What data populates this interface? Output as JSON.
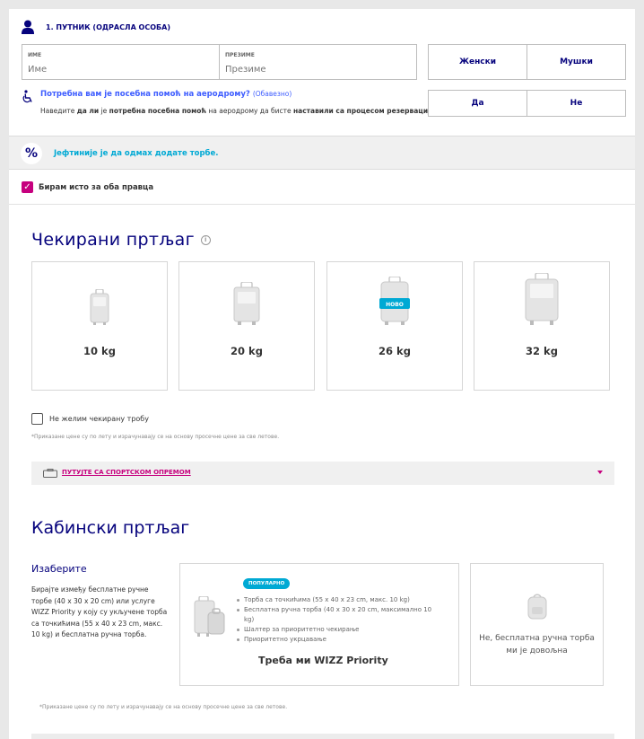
{
  "passenger": {
    "title": "1. ПУТНИК (ОДРАСЛА ОСОБА)",
    "first_name_label": "ИМЕ",
    "first_name_placeholder": "Име",
    "last_name_label": "ПРЕЗИМЕ",
    "last_name_placeholder": "Презиме",
    "gender_female": "Женски",
    "gender_male": "Мушки"
  },
  "assistance": {
    "question": "Потребна вам је посебна помоћ на аеродрому?",
    "optional": "(Обавезно)",
    "desc_1": "Наведите ",
    "desc_2": "да ли",
    "desc_3": " је ",
    "desc_4": "потребна посебна помоћ",
    "desc_5": " на аеродрому да бисте ",
    "desc_6": "наставили са процесом резервације.",
    "yes": "Да",
    "no": "Не"
  },
  "promo": {
    "icon": "%",
    "text": "Јефтиније је да одмах додате торбе."
  },
  "both_directions": {
    "label": "Бирам исто за оба правца",
    "checked": true
  },
  "checked_baggage": {
    "heading": "Чекирани пртљаг",
    "info_icon": "i",
    "options": [
      {
        "weight": "10 kg"
      },
      {
        "weight": "20 kg"
      },
      {
        "weight": "26 kg",
        "badge": "НОВО"
      },
      {
        "weight": "32 kg"
      }
    ],
    "no_bag_label": "Не желим чекирану тробу",
    "note": "*Приказане цене су по лету и израчунавају се на основу просечне цене за све летове."
  },
  "sport": {
    "label": "ПУТУЈТЕ СА СПОРТСКОМ ОПРЕМОМ"
  },
  "cabin": {
    "heading": "Кабински пртљаг",
    "choose_heading": "Изаберите",
    "choose_desc": "Бирајте између бесплатне ручне торбе (40 x 30 x 20 cm) или услуге WIZZ Priority у коју су укључене торба са точкићима (55 x 40 x 23 cm, макс. 10 kg) и бесплатна ручна торба.",
    "priority": {
      "badge": "ПОПУЛАРНО",
      "features": [
        "Торба са точкићима (55 x 40 x 23 cm, макс. 10 kg)",
        "Бесплатна ручна торба (40 x 30 x 20 cm, максимално 10 kg)",
        "Шалтер за приоритетно чекирање",
        "Приоритетно укрцавање"
      ],
      "name": "Треба ми WIZZ Priority"
    },
    "free": {
      "label": "Не, бесплатна ручна торба ми је довољна"
    },
    "note": "*Приказане цене су по лету и израчунавају се на основу просечне цене за све летове."
  },
  "colors": {
    "navy": "#06037d",
    "magenta": "#c6007e",
    "cyan": "#00a9d4",
    "link_blue": "#3d5cff"
  }
}
